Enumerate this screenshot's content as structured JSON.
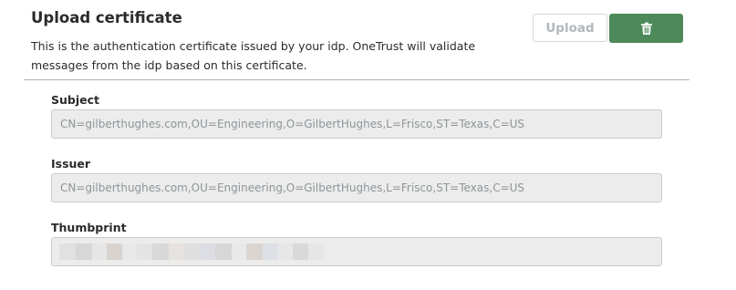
{
  "header": {
    "title": "Upload certificate",
    "description": "This is the authentication certificate issued by your idp. OneTrust will validate messages from the idp based on this certificate."
  },
  "actions": {
    "upload_label": "Upload",
    "delete_icon": "trash-icon",
    "delete_color": "#4e8a59"
  },
  "fields": {
    "subject": {
      "label": "Subject",
      "value": "CN=gilberthughes.com,OU=Engineering,O=GilbertHughes,L=Frisco,ST=Texas,C=US"
    },
    "issuer": {
      "label": "Issuer",
      "value": "CN=gilberthughes.com,OU=Engineering,O=GilbertHughes,L=Frisco,ST=Texas,C=US"
    },
    "thumbprint": {
      "label": "Thumbprint",
      "value_redacted": true
    }
  }
}
